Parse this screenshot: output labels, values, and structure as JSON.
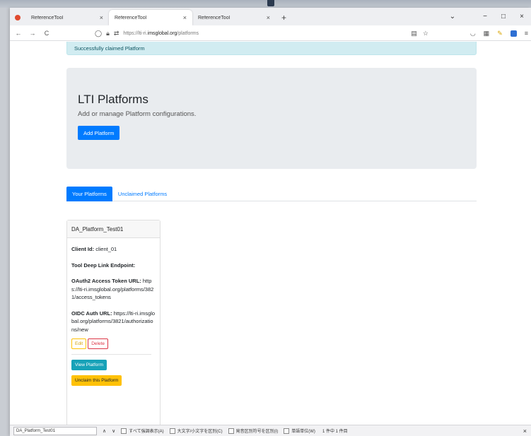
{
  "browser": {
    "tabs": [
      {
        "title": "ReferenceTool",
        "close": "×"
      },
      {
        "title": "ReferenceTool",
        "close": "×"
      },
      {
        "title": "ReferenceTool",
        "close": "×"
      }
    ],
    "new_tab": "+",
    "window_controls": {
      "dropdown": "⌄",
      "minimize": "−",
      "maximize": "□",
      "close": "×"
    },
    "nav": {
      "back": "←",
      "forward": "→",
      "reload": "C"
    },
    "url": {
      "prefix": "https://lti-ri.",
      "domain": "imsglobal.org",
      "path": "/platforms"
    }
  },
  "alert": {
    "text": "Successfully claimed Platform"
  },
  "jumbotron": {
    "title": "LTI Platforms",
    "lead": "Add or manage Platform configurations.",
    "add_button": "Add Platform"
  },
  "tabs": [
    {
      "label": "Your Platforms"
    },
    {
      "label": "Unclaimed Platforms"
    }
  ],
  "platform_card": {
    "name": "DA_Platform_Test01",
    "client_id_label": "Client Id:",
    "client_id_value": "client_01",
    "deep_link_label": "Tool Deep Link Endpoint:",
    "oauth_label": "OAuth2 Access Token URL:",
    "oauth_value": "https://lti-ri.imsglobal.org/platforms/3821/access_tokens",
    "oidc_label": "OIDC Auth URL:",
    "oidc_value": "https://lti-ri.imsglobal.org/platforms/3821/authorizations/new",
    "edit_button": "Edit",
    "delete_button": "Delete",
    "view_button": "View Platform",
    "unclaim_button": "Unclaim this Platform"
  },
  "findbar": {
    "query": "DA_Platform_Test01",
    "up": "∧",
    "down": "∨",
    "options": [
      "すべて強調表示(A)",
      "大文字/小文字を区別(C)",
      "発音区別符号を区別(I)",
      "単語単位(W)"
    ],
    "result": "1 件中 1 件目",
    "close": "×"
  },
  "colors": {
    "primary": "#007bff",
    "info": "#17a2b8",
    "warning": "#ffc107",
    "danger": "#dc3545",
    "alert_bg": "#d1ecf1",
    "jumbotron_bg": "#e9ecef"
  }
}
